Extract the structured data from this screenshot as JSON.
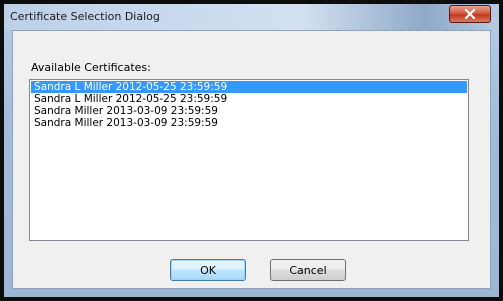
{
  "window": {
    "title": "Certificate Selection Dialog",
    "close_icon": "close-x-icon"
  },
  "dialog": {
    "label": "Available Certificates:",
    "certificates": [
      {
        "label": "Sandra L Miller 2012-05-25 23:59:59",
        "selected": true
      },
      {
        "label": "Sandra L Miller 2012-05-25 23:59:59",
        "selected": false
      },
      {
        "label": "Sandra Miller 2013-03-09 23:59:59",
        "selected": false
      },
      {
        "label": "Sandra Miller 2013-03-09 23:59:59",
        "selected": false
      }
    ],
    "ok_label": "OK",
    "cancel_label": "Cancel"
  },
  "colors": {
    "selection": "#3399ff",
    "close_button": "#c3361d"
  }
}
